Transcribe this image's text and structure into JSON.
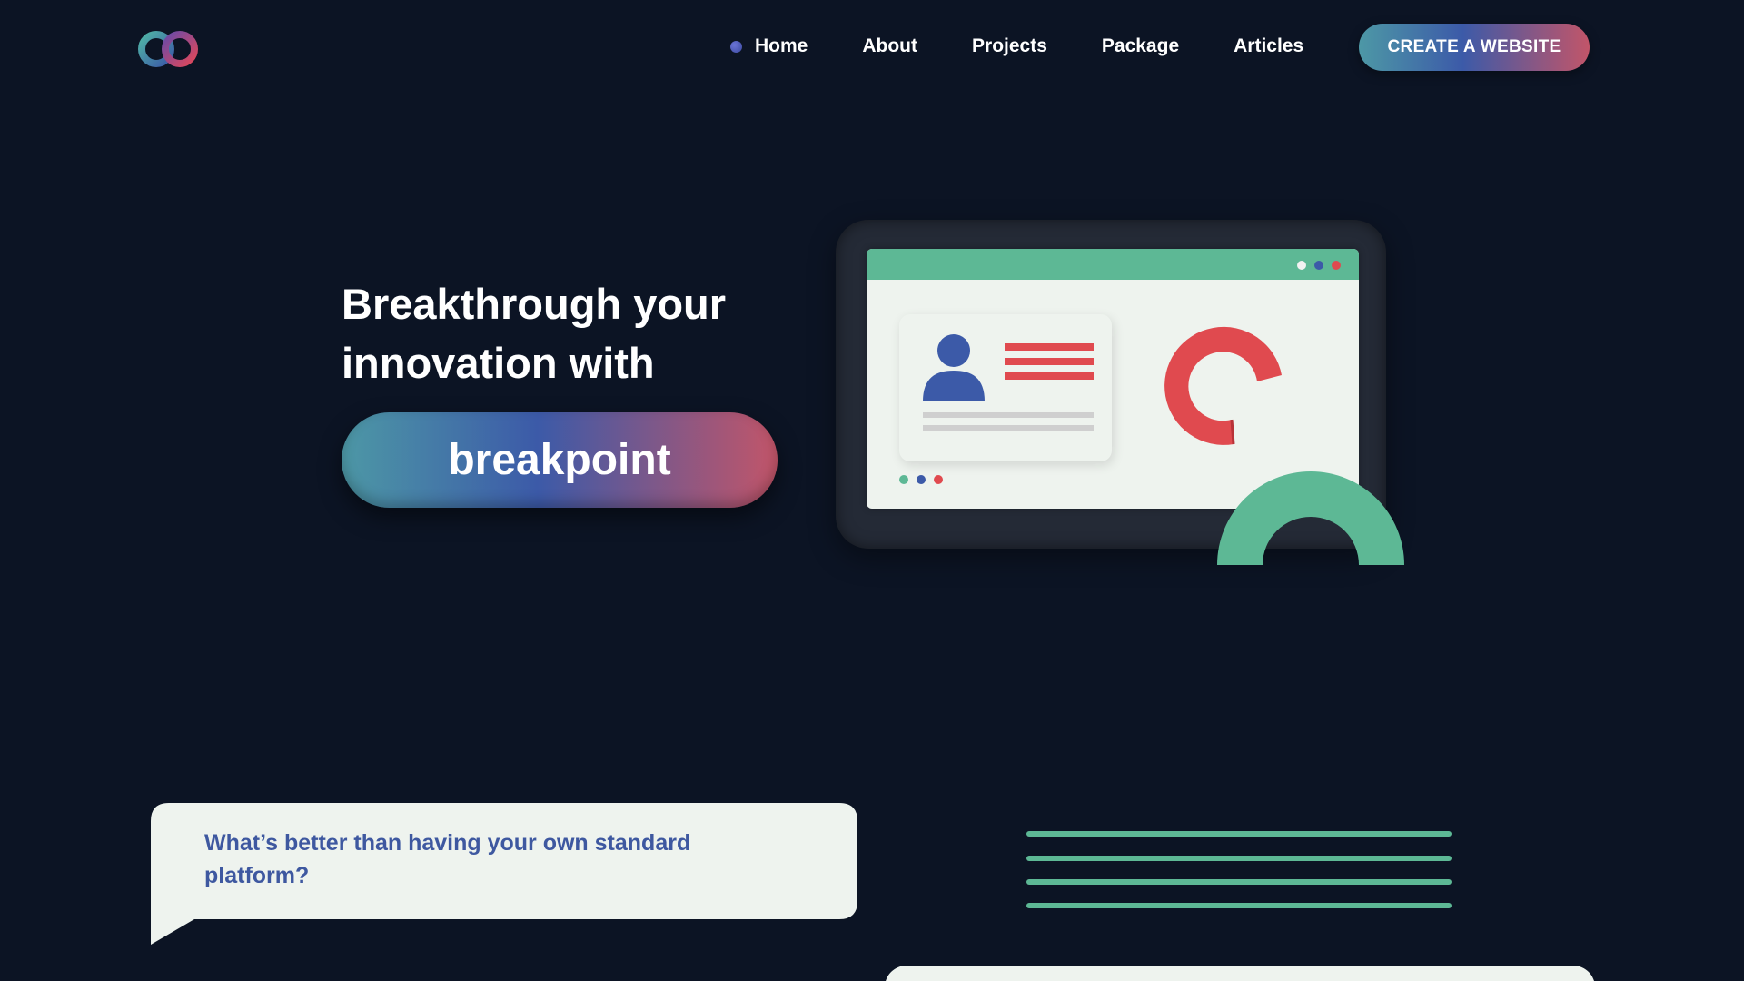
{
  "nav": {
    "items": [
      {
        "label": "Home",
        "active": true
      },
      {
        "label": "About"
      },
      {
        "label": "Projects"
      },
      {
        "label": "Package"
      },
      {
        "label": "Articles"
      }
    ],
    "cta_label": "CREATE A WEBSITE"
  },
  "hero": {
    "title_line1": "Breakthrough your",
    "title_line2": "innovation with",
    "brand_word": "breakpoint"
  },
  "feature": {
    "question": "What’s better than having your own standard platform?"
  },
  "colors": {
    "background": "#0c1424",
    "green_accent": "#5db895",
    "blue_accent": "#3c5aa8",
    "red_accent": "#e04a4f",
    "card_bg": "#eef3ee",
    "question_text": "#3e58a0"
  },
  "icons": {
    "logo": "bp-logo",
    "active_nav": "dot-icon",
    "profile": "person-icon",
    "chart": "donut-chart-icon"
  }
}
